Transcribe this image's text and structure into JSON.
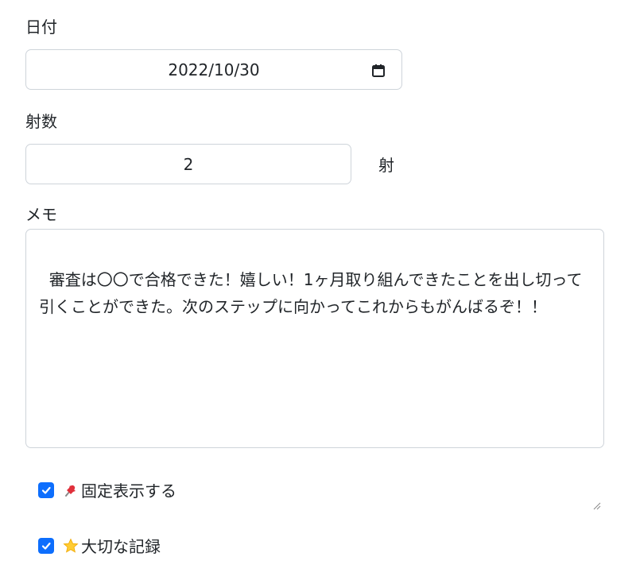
{
  "date_field": {
    "label": "日付",
    "value": "2022/10/30",
    "icon": "calendar-icon"
  },
  "shots_field": {
    "label": "射数",
    "value": "2",
    "unit": "射"
  },
  "memo_field": {
    "label": "メモ",
    "value": "審査は〇〇で合格できた！嬉しい！1ヶ月取り組んできたことを出し切って引くことができた。次のステップに向かってこれからもがんばるぞ！！"
  },
  "checkboxes": [
    {
      "label": "固定表示する",
      "checked": true,
      "icon": "pushpin-icon"
    },
    {
      "label": "大切な記録",
      "checked": true,
      "icon": "star-icon"
    }
  ],
  "colors": {
    "checkbox_accent": "#0d6efd",
    "border": "#ced4da",
    "text": "#212529"
  }
}
